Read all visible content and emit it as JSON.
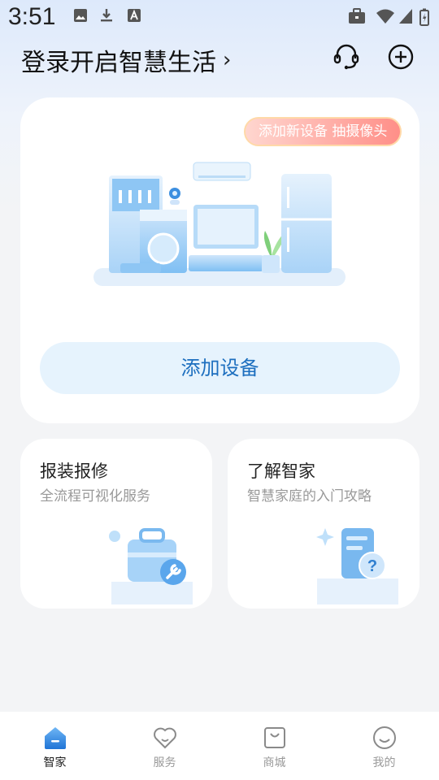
{
  "status_bar": {
    "time": "3:51"
  },
  "header": {
    "login_prompt": "登录开启智慧生活",
    "chevron": "›"
  },
  "main_card": {
    "promo_badge": "添加新设备 抽摄像头",
    "add_device_button": "添加设备"
  },
  "service_cards": [
    {
      "title": "报装报修",
      "subtitle": "全流程可视化服务"
    },
    {
      "title": "了解智家",
      "subtitle": "智慧家庭的入门攻略"
    }
  ],
  "bottom_nav": {
    "items": [
      {
        "label": "智家",
        "icon": "home-icon",
        "active": true
      },
      {
        "label": "服务",
        "icon": "heart-icon",
        "active": false
      },
      {
        "label": "商城",
        "icon": "shopping-bag-icon",
        "active": false
      },
      {
        "label": "我的",
        "icon": "smiley-icon",
        "active": false
      }
    ]
  },
  "colors": {
    "accent_blue": "#1d6fbf",
    "button_bg": "#e6f3fd",
    "badge_gradient_start": "#ffd6cf",
    "badge_gradient_end": "#ff8f88"
  }
}
